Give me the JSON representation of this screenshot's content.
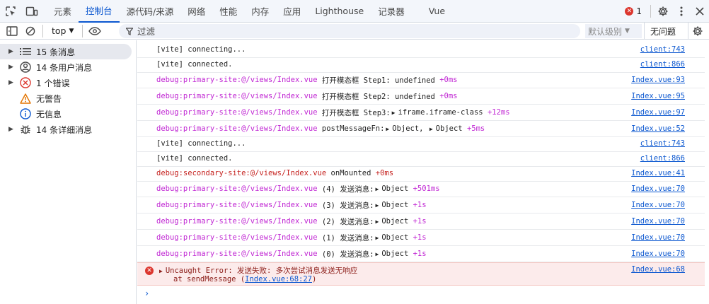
{
  "tabbar": {
    "tabs": [
      "元素",
      "控制台",
      "源代码/来源",
      "网络",
      "性能",
      "内存",
      "应用",
      "Lighthouse",
      "记录器",
      "Vue"
    ],
    "active_tab": "控制台",
    "error_count": "1",
    "icons": [
      "inspect-icon",
      "device-toolbar-icon",
      "settings-icon",
      "more-vert-icon",
      "close-icon"
    ]
  },
  "toolbar": {
    "context": "top",
    "filter_placeholder": "过滤",
    "levels": "默认级别",
    "issues": "无问题"
  },
  "sidebar": {
    "items": [
      {
        "label": "15 条消息",
        "icon": "list-icon",
        "expandable": true,
        "selected": true
      },
      {
        "label": "14 条用户消息",
        "icon": "user-icon",
        "expandable": true
      },
      {
        "label": "1 个错误",
        "icon": "error-icon",
        "expandable": true
      },
      {
        "label": "无警告",
        "icon": "warning-icon",
        "expandable": false
      },
      {
        "label": "无信息",
        "icon": "info-icon",
        "expandable": false
      },
      {
        "label": "14 条详细消息",
        "icon": "bug-icon",
        "expandable": true
      }
    ]
  },
  "console": {
    "messages": [
      {
        "prefix": "",
        "text": "[vite] connecting...",
        "source": "client:743"
      },
      {
        "prefix": "",
        "text": "[vite] connected.",
        "source": "client:866"
      },
      {
        "prefix": "debug:primary-site:@/views/Index.vue",
        "text": "打开模态框 Step1: undefined",
        "time": "+0ms",
        "source": "Index.vue:93"
      },
      {
        "prefix": "debug:primary-site:@/views/Index.vue",
        "text": "打开模态框 Step2: undefined",
        "time": "+0ms",
        "source": "Index.vue:95"
      },
      {
        "prefix": "debug:primary-site:@/views/Index.vue",
        "text": "打开模态框 Step3: ",
        "obj": "iframe.iframe-class",
        "time": "+12ms",
        "source": "Index.vue:97"
      },
      {
        "prefix": "debug:primary-site:@/views/Index.vue",
        "text": "postMessageFn: ",
        "obj": "Object,",
        "obj2": "Object",
        "time": "+5ms",
        "source": "Index.vue:52"
      },
      {
        "prefix": "",
        "text": "[vite] connecting...",
        "source": "client:743"
      },
      {
        "prefix": "",
        "text": "[vite] connected.",
        "source": "client:866"
      },
      {
        "prefix": "debug:secondary-site:@/views/Index.vue",
        "text": "onMounted",
        "time": "+0ms",
        "source": "Index.vue:41",
        "secondary": true
      },
      {
        "prefix": "debug:primary-site:@/views/Index.vue",
        "text": "(4) 发送消息: ",
        "obj": "Object",
        "time": "+501ms",
        "source": "Index.vue:70"
      },
      {
        "prefix": "debug:primary-site:@/views/Index.vue",
        "text": "(3) 发送消息: ",
        "obj": "Object",
        "time": "+1s",
        "source": "Index.vue:70"
      },
      {
        "prefix": "debug:primary-site:@/views/Index.vue",
        "text": "(2) 发送消息: ",
        "obj": "Object",
        "time": "+1s",
        "source": "Index.vue:70"
      },
      {
        "prefix": "debug:primary-site:@/views/Index.vue",
        "text": "(1) 发送消息: ",
        "obj": "Object",
        "time": "+1s",
        "source": "Index.vue:70"
      },
      {
        "prefix": "debug:primary-site:@/views/Index.vue",
        "text": "(0) 发送消息: ",
        "obj": "Object",
        "time": "+1s",
        "source": "Index.vue:70"
      }
    ],
    "error": {
      "line1": "Uncaught Error: 发送失败: 多次尝试消息发送无响应",
      "line2_prefix": "at sendMessage (",
      "line2_link": "Index.vue:68:27",
      "line2_suffix": ")",
      "source": "Index.vue:68"
    },
    "prompt": "›"
  }
}
